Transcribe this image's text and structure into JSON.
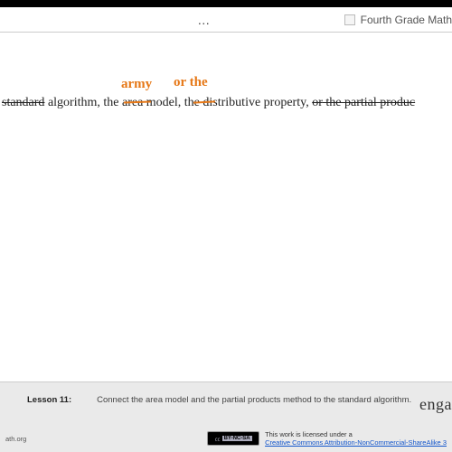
{
  "topbar": {
    "ellipsis": "…",
    "gradeLabel": "Fourth Grade Math"
  },
  "main": {
    "word_standard": "standard",
    "text_alg": " algorithm, the ",
    "word_area": "area",
    "text_model": " model, ",
    "word_the": "the ",
    "text_dist": "distributive property, ",
    "word_or": "or",
    "text_partial": " the partial produc"
  },
  "annotations": {
    "army": "army",
    "orthe": "or the"
  },
  "footer": {
    "lessonLabel": "Lesson 11:",
    "lessonDesc": "Connect the area model and the partial products method to the standard algorithm.",
    "brand": "enga",
    "siteFragment": "ath.org",
    "ccBadge": "BY-NC-SA",
    "licenseLine1": "This work is licensed under a",
    "licenseLink": "Creative Commons Attribution-NonCommercial-ShareAlike 3"
  }
}
